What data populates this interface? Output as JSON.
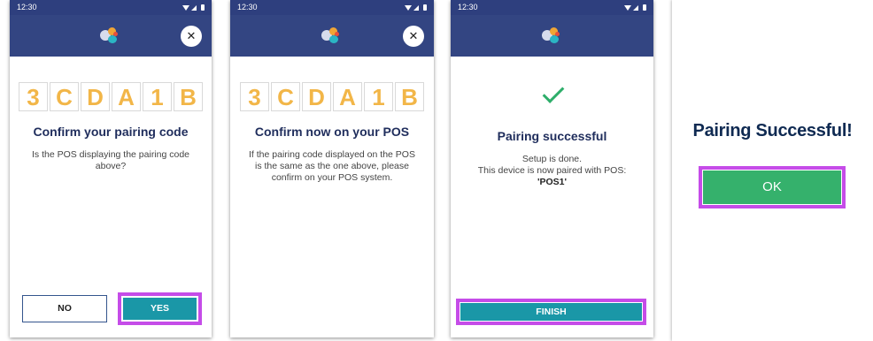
{
  "status_time": "12:30",
  "code_chars": [
    "3",
    "C",
    "D",
    "A",
    "1",
    "B"
  ],
  "screen1": {
    "title": "Confirm your pairing code",
    "body": "Is the POS displaying the pairing code above?",
    "no_label": "NO",
    "yes_label": "YES"
  },
  "screen2": {
    "title": "Confirm now on your POS",
    "body": "If the pairing code displayed on the POS is the same as the one above, please confirm on your POS system."
  },
  "screen3": {
    "title": "Pairing successful",
    "line1": "Setup is done.",
    "line2": "This device is now paired with POS:",
    "pos_name": "'POS1'",
    "finish_label": "FINISH"
  },
  "screen4": {
    "title": "Pairing Successful!",
    "ok_label": "OK"
  },
  "colors": {
    "header": "#334582",
    "code_digit": "#f2b648",
    "primary_button": "#1a97a7",
    "ok_button": "#35b16c",
    "highlight": "#c54ce8",
    "success_check": "#2eae6a"
  },
  "icons": [
    "close-icon",
    "app-logo-icon",
    "checkmark-icon",
    "wifi-icon",
    "signal-icon",
    "battery-icon"
  ]
}
